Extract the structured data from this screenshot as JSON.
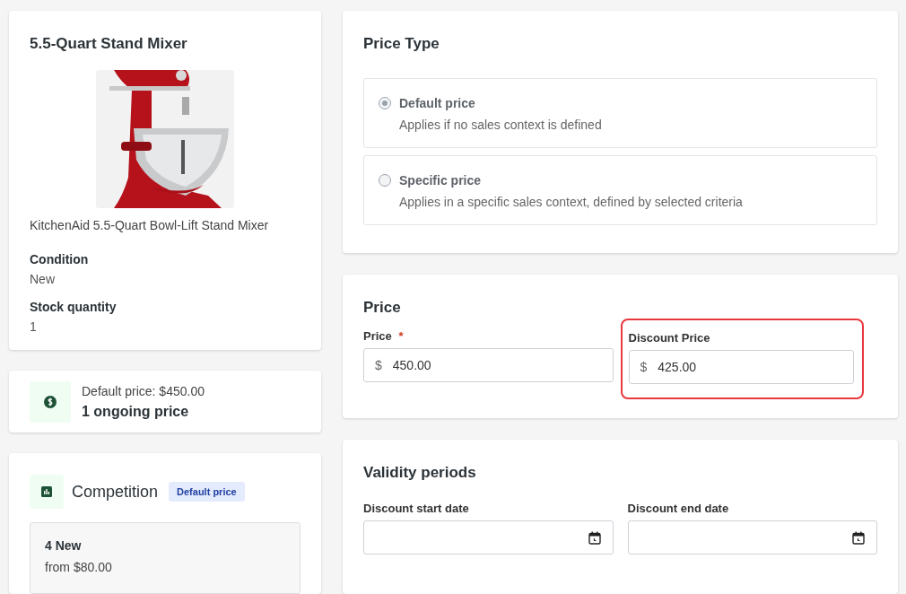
{
  "product": {
    "title": "5.5-Quart Stand Mixer",
    "caption": "KitchenAid 5.5-Quart Bowl-Lift Stand Mixer",
    "details": [
      {
        "label": "Condition",
        "value": "New"
      },
      {
        "label": "Stock quantity",
        "value": "1"
      }
    ]
  },
  "price_summary": {
    "default_price": "Default price: $450.00",
    "ongoing": "1 ongoing price"
  },
  "competition": {
    "title": "Competition",
    "badge": "Default price",
    "offers": [
      {
        "count": "4 New",
        "from": "from $80.00"
      }
    ]
  },
  "price_type": {
    "title": "Price Type",
    "options": [
      {
        "label": "Default price",
        "description": "Applies if no sales context is defined",
        "selected": true,
        "disabled": true
      },
      {
        "label": "Specific price",
        "description": "Applies in a specific sales context, defined by selected criteria",
        "selected": false,
        "disabled": true
      }
    ]
  },
  "price": {
    "title": "Price",
    "fields": [
      {
        "label": "Price",
        "required_mark": "*",
        "currency": "$",
        "value": "450.00",
        "highlighted": false
      },
      {
        "label": "Discount Price",
        "currency": "$",
        "value": "425.00",
        "highlighted": true
      }
    ]
  },
  "validity": {
    "title": "Validity periods",
    "fields": [
      {
        "label": "Discount start date"
      },
      {
        "label": "Discount end date"
      }
    ]
  }
}
